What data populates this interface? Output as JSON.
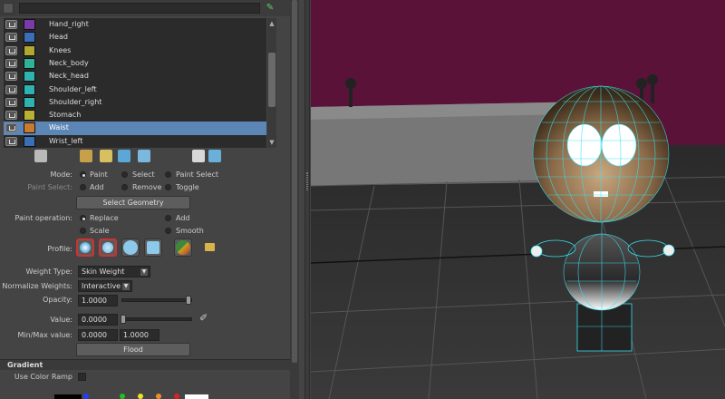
{
  "influence_list": {
    "items": [
      {
        "label": "Hand_right",
        "color": "#7a3aa8"
      },
      {
        "label": "Head",
        "color": "#3a6fb8"
      },
      {
        "label": "Knees",
        "color": "#b0a830"
      },
      {
        "label": "Neck_body",
        "color": "#2eb39a"
      },
      {
        "label": "Neck_head",
        "color": "#2eb3b0"
      },
      {
        "label": "Shoulder_left",
        "color": "#2eb3b3"
      },
      {
        "label": "Shoulder_right",
        "color": "#2eb3b3"
      },
      {
        "label": "Stomach",
        "color": "#b8b033"
      },
      {
        "label": "Waist",
        "color": "#c87a2e",
        "selected": true
      },
      {
        "label": "Wrist_left",
        "color": "#3a6fb8"
      }
    ]
  },
  "controls": {
    "mode_label": "Mode:",
    "mode_paint": "Paint",
    "mode_select": "Select",
    "mode_paint_select": "Paint Select",
    "paint_select_label": "Paint Select:",
    "ps_add": "Add",
    "ps_remove": "Remove",
    "ps_toggle": "Toggle",
    "select_geometry": "Select Geometry",
    "paint_op_label": "Paint operation:",
    "op_replace": "Replace",
    "op_add": "Add",
    "op_scale": "Scale",
    "op_smooth": "Smooth",
    "profile_label": "Profile:",
    "weight_type_label": "Weight Type:",
    "weight_type_value": "Skin Weight",
    "normalize_label": "Normalize Weights:",
    "normalize_value": "Interactive",
    "opacity_label": "Opacity:",
    "opacity_value": "1.0000",
    "value_label": "Value:",
    "value_value": "0.0000",
    "minmax_label": "Min/Max value:",
    "min_value": "0.0000",
    "max_value": "1.0000",
    "flood": "Flood"
  },
  "gradient": {
    "header": "Gradient",
    "use_color_ramp": "Use Color Ramp"
  },
  "colors": {
    "selection": "#5b86b6",
    "wireframe": "#38e0f0",
    "background_wall": "#5a1238"
  }
}
